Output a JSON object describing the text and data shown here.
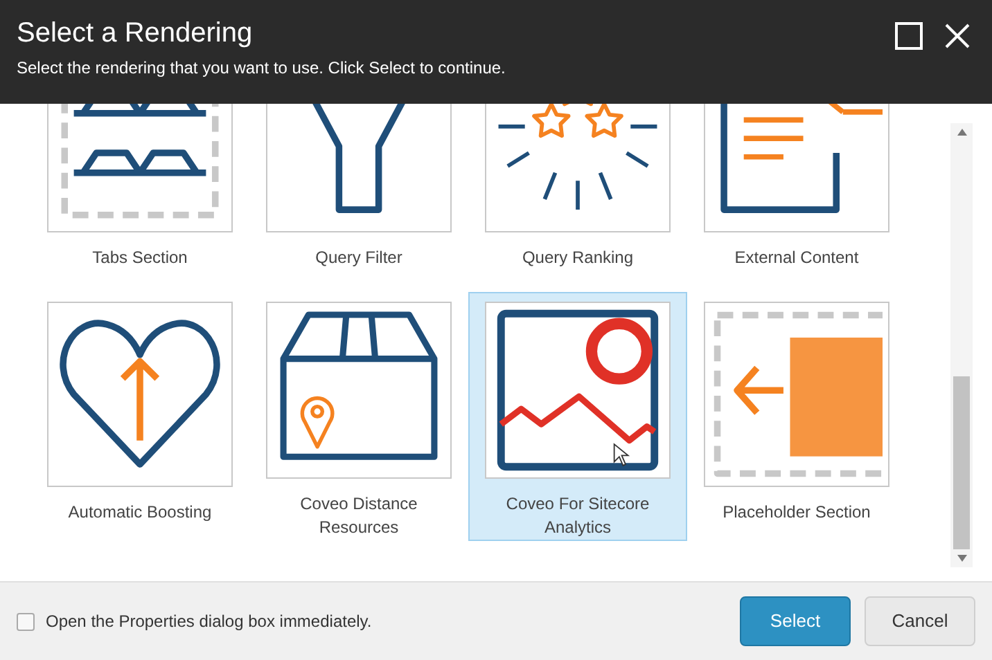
{
  "window": {
    "title": "Select a Rendering",
    "subtitle": "Select the rendering that you want to use. Click Select to continue."
  },
  "renderings": [
    {
      "label": "Tabs Section",
      "kind": "tabs",
      "selected": false
    },
    {
      "label": "Query Filter",
      "kind": "filter",
      "selected": false
    },
    {
      "label": "Query Ranking",
      "kind": "ranking",
      "selected": false
    },
    {
      "label": "External Content",
      "kind": "external",
      "selected": false
    },
    {
      "label": "Automatic Boosting",
      "kind": "boosting",
      "selected": false
    },
    {
      "label": "Coveo Distance Resources",
      "kind": "distance",
      "selected": false
    },
    {
      "label": "Coveo For Sitecore Analytics",
      "kind": "analytics",
      "selected": true
    },
    {
      "label": "Placeholder Section",
      "kind": "placeholder",
      "selected": false
    }
  ],
  "footer": {
    "checkbox": {
      "label": "Open the Properties dialog box immediately.",
      "checked": false
    },
    "buttons": [
      {
        "label": "Select",
        "kind": "primary"
      },
      {
        "label": "Cancel",
        "kind": "secondary"
      }
    ]
  }
}
